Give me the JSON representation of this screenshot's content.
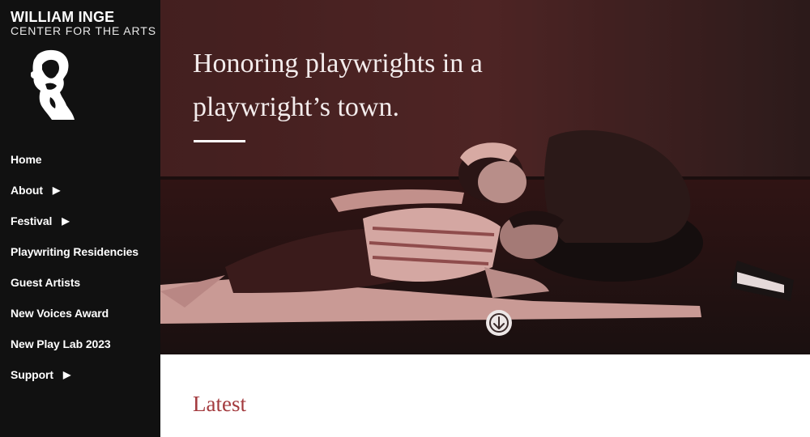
{
  "brand": {
    "name": "WILLIAM INGE",
    "subtitle": "CENTER FOR THE ARTS",
    "logo_icon": "playwright-portrait-logo"
  },
  "nav": {
    "items": [
      {
        "label": "Home",
        "has_submenu": false
      },
      {
        "label": "About",
        "has_submenu": true
      },
      {
        "label": "Festival",
        "has_submenu": true
      },
      {
        "label": "Playwriting Residencies",
        "has_submenu": false
      },
      {
        "label": "Guest Artists",
        "has_submenu": false
      },
      {
        "label": "New Voices Award",
        "has_submenu": false
      },
      {
        "label": "New Play Lab 2023",
        "has_submenu": false
      },
      {
        "label": "Support",
        "has_submenu": true
      }
    ],
    "submenu_icon": "triangle-right-icon"
  },
  "hero": {
    "title": "Honoring playwrights in a playwright’s town.",
    "scroll_icon": "arrow-down-circle-icon"
  },
  "main": {
    "section_heading": "Latest"
  },
  "colors": {
    "sidebar_bg": "#111111",
    "hero_tint": "#7a2a2a",
    "accent": "#a33a3e"
  }
}
